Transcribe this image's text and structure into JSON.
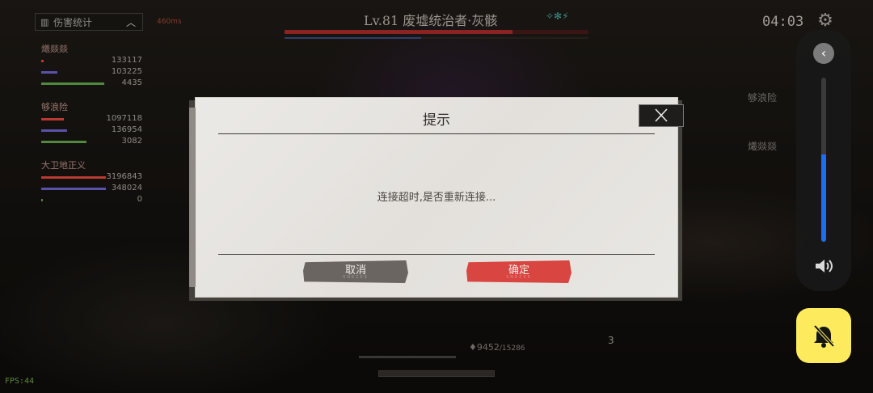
{
  "damage_panel": {
    "header_icon": "bar-chart-icon",
    "header_label": "伤害统计",
    "players": [
      {
        "name": "爔燚燚",
        "stats": [
          {
            "value": "133117",
            "fill": 0.04,
            "color": "#b83a32"
          },
          {
            "value": "103225",
            "fill": 0.25,
            "color": "#5a52a8"
          },
          {
            "value": "4435",
            "fill": 0.98,
            "color": "#4f8a3e"
          }
        ]
      },
      {
        "name": "够浪险",
        "stats": [
          {
            "value": "1097118",
            "fill": 0.35,
            "color": "#b83a32"
          },
          {
            "value": "136954",
            "fill": 0.4,
            "color": "#5a52a8"
          },
          {
            "value": "3082",
            "fill": 0.7,
            "color": "#4f8a3e"
          }
        ]
      },
      {
        "name": "大卫地正义",
        "stats": [
          {
            "value": "3196843",
            "fill": 1.0,
            "color": "#b83a32"
          },
          {
            "value": "348024",
            "fill": 1.0,
            "color": "#5a52a8"
          },
          {
            "value": "0",
            "fill": 0.02,
            "color": "#4f8a3e"
          }
        ]
      }
    ]
  },
  "boss": {
    "title": "Lv.81  废墟统治者·灰骸",
    "latency": "460ms",
    "status_icons": "✧✻⚡",
    "hp_fraction": 0.75,
    "shield_fraction": 0.45
  },
  "timer": "04:03",
  "side_labels": {
    "top": "够浪险",
    "bottom": "爔燚燚"
  },
  "skill_count": "3",
  "hp_readout": {
    "current": "9452",
    "max": "/15286"
  },
  "fps": "FPS:44",
  "volume": {
    "level": 0.53
  },
  "dialog": {
    "title": "提示",
    "message": "连接超时,是否重新连接...",
    "cancel_label": "取消",
    "confirm_label": "确定",
    "button_sub": "SNEZEE"
  }
}
